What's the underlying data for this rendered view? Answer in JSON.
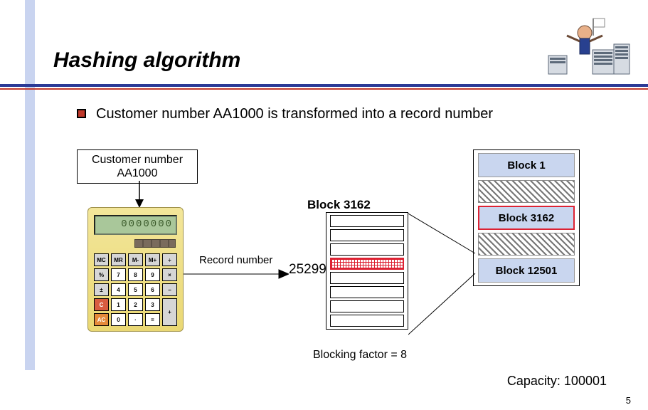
{
  "title": "Hashing algorithm",
  "bullet": "Customer number AA1000 is transformed into a record number",
  "customer_box_line1": "Customer number",
  "customer_box_line2": "AA1000",
  "record_label": "Record number",
  "record_number": "25299",
  "mid_block_label": "Block 3162",
  "blocking_factor": "Blocking factor = 8",
  "storage": {
    "block1": "Block 1",
    "block_mid": "Block 3162",
    "block_last": "Block 12501"
  },
  "capacity": "Capacity: 100001",
  "calculator_display": "0000000",
  "calc_keys": [
    {
      "t": "MC",
      "c": "gray"
    },
    {
      "t": "MR",
      "c": "gray"
    },
    {
      "t": "M-",
      "c": "gray"
    },
    {
      "t": "M+",
      "c": "gray"
    },
    {
      "t": "÷",
      "c": "gray"
    },
    {
      "t": "%",
      "c": "gray"
    },
    {
      "t": "7",
      "c": "white"
    },
    {
      "t": "8",
      "c": "white"
    },
    {
      "t": "9",
      "c": "white"
    },
    {
      "t": "×",
      "c": "gray"
    },
    {
      "t": "±",
      "c": "gray"
    },
    {
      "t": "4",
      "c": "white"
    },
    {
      "t": "5",
      "c": "white"
    },
    {
      "t": "6",
      "c": "white"
    },
    {
      "t": "−",
      "c": "gray"
    },
    {
      "t": "C",
      "c": "red"
    },
    {
      "t": "1",
      "c": "white"
    },
    {
      "t": "2",
      "c": "white"
    },
    {
      "t": "3",
      "c": "white"
    },
    {
      "t": "+",
      "c": "gray",
      "plus": true
    },
    {
      "t": "AC",
      "c": "orange"
    },
    {
      "t": "0",
      "c": "white"
    },
    {
      "t": "·",
      "c": "white"
    },
    {
      "t": "=",
      "c": "white"
    }
  ],
  "page_number": "5"
}
